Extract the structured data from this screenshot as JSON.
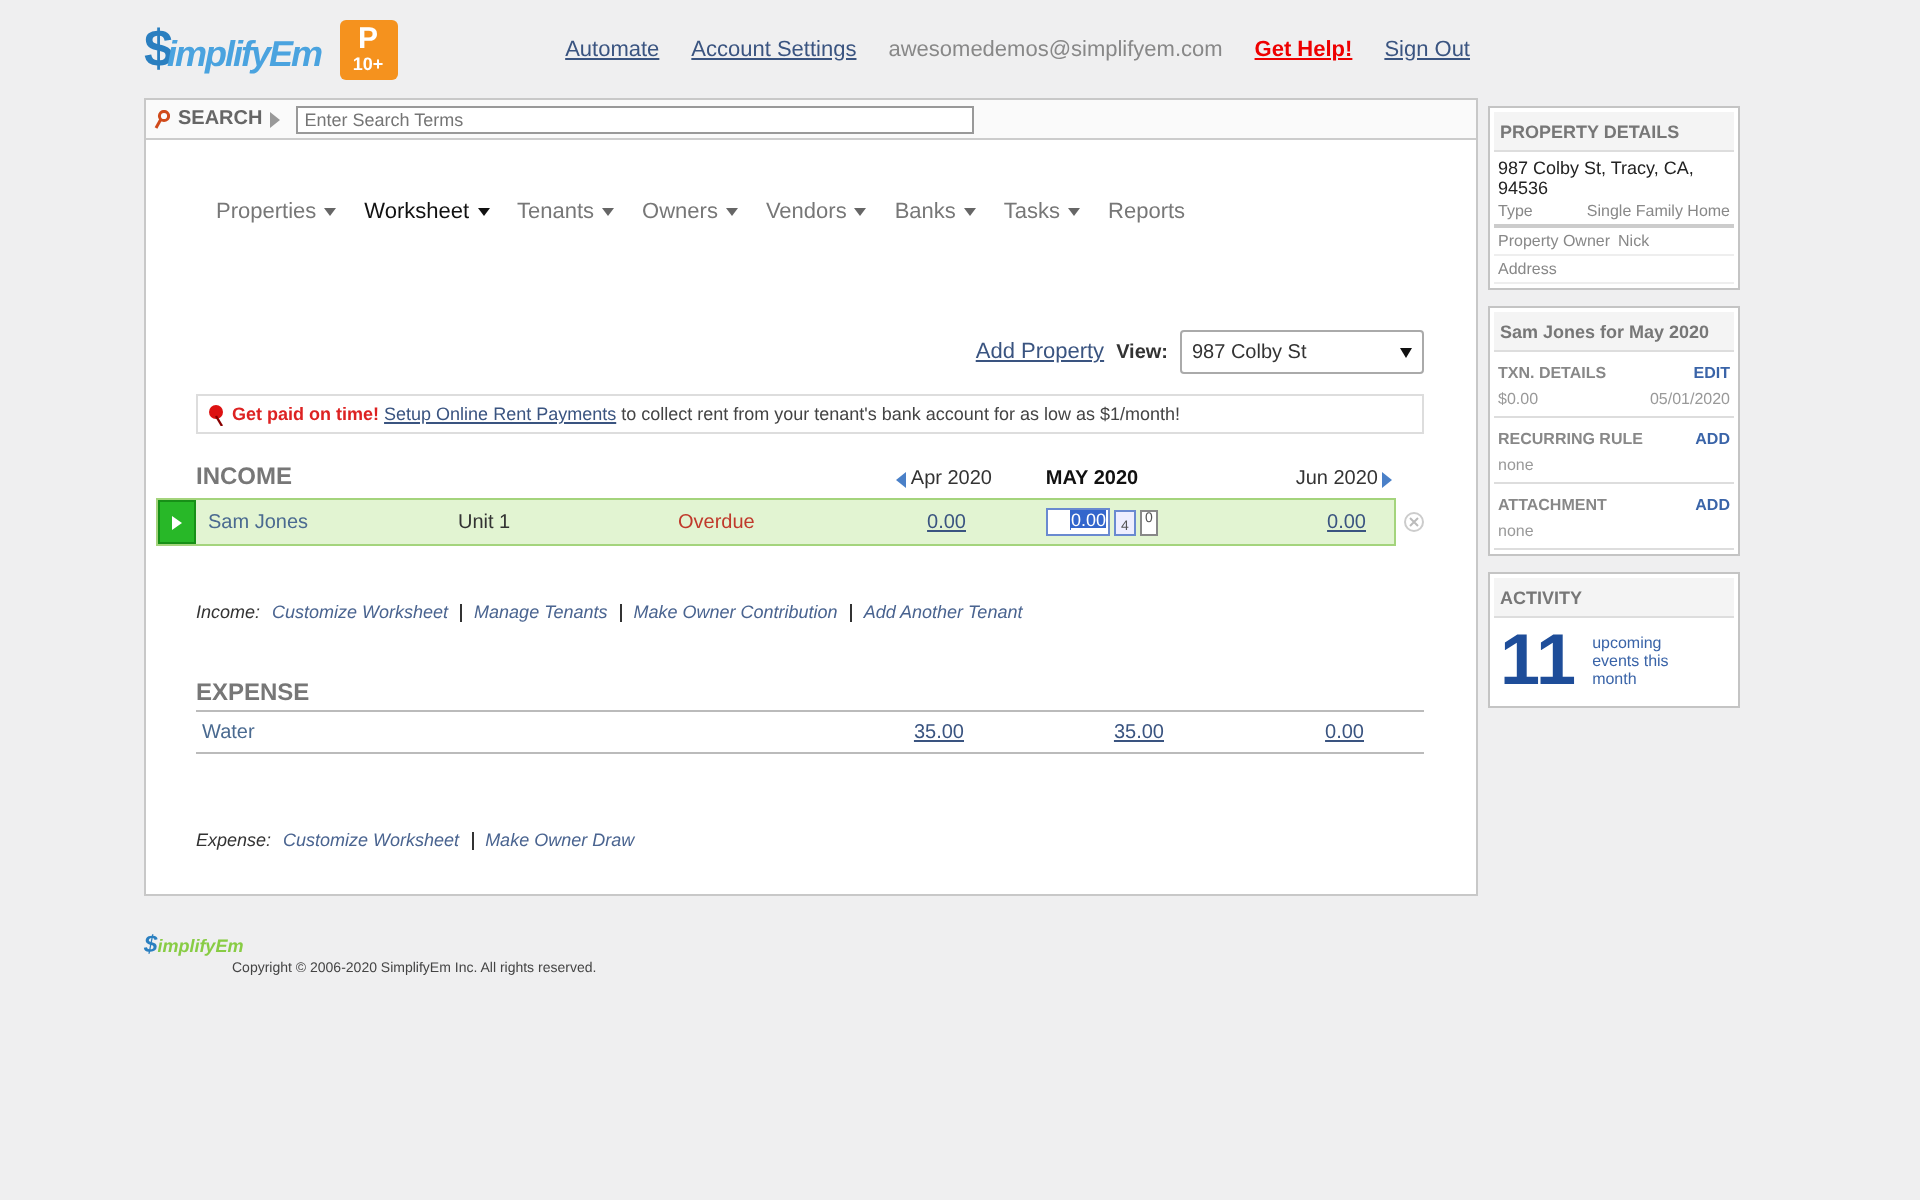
{
  "header": {
    "logo_mark": "$",
    "logo": "implifyEm",
    "badge_letter": "P",
    "badge_sub": "10+",
    "links": [
      {
        "label": "Automate",
        "kind": "link"
      },
      {
        "label": "Account Settings",
        "kind": "link"
      },
      {
        "label": "awesomedemos@simplifyem.com",
        "kind": "email"
      },
      {
        "label": "Get Help!",
        "kind": "help"
      },
      {
        "label": "Sign Out",
        "kind": "link"
      }
    ]
  },
  "search": {
    "label": "SEARCH",
    "placeholder": "Enter Search Terms"
  },
  "nav": [
    {
      "label": "Properties",
      "dropdown": true,
      "selected": false
    },
    {
      "label": "Worksheet",
      "dropdown": true,
      "selected": true
    },
    {
      "label": "Tenants",
      "dropdown": true,
      "selected": false
    },
    {
      "label": "Owners",
      "dropdown": true,
      "selected": false
    },
    {
      "label": "Vendors",
      "dropdown": true,
      "selected": false
    },
    {
      "label": "Banks",
      "dropdown": true,
      "selected": false
    },
    {
      "label": "Tasks",
      "dropdown": true,
      "selected": false
    },
    {
      "label": "Reports",
      "dropdown": false,
      "selected": false
    }
  ],
  "view": {
    "add_link": "Add Property",
    "label": "View:",
    "value": "987 Colby St"
  },
  "promo": {
    "lead": "Get paid on time!",
    "link": "Setup Online Rent Payments",
    "text": "to collect rent from your tenant's bank account for as low as $1/month!"
  },
  "income": {
    "title": "INCOME",
    "months": [
      {
        "label": "Apr 2020",
        "current": false,
        "prev_arrow": true,
        "next_arrow": false
      },
      {
        "label": "MAY 2020",
        "current": true,
        "prev_arrow": false,
        "next_arrow": false
      },
      {
        "label": "Jun 2020",
        "current": false,
        "prev_arrow": false,
        "next_arrow": true
      }
    ],
    "rows": [
      {
        "name": "Sam Jones",
        "unit": "Unit 1",
        "status": "Overdue",
        "values": [
          {
            "amount": "0.00",
            "editing": false
          },
          {
            "amount": "0.00",
            "editing": true
          },
          {
            "amount": "0.00",
            "editing": false
          }
        ],
        "calendar_count": "4",
        "note_count": "0"
      }
    ],
    "links_label": "Income:",
    "links": [
      "Customize Worksheet",
      "Manage Tenants",
      "Make Owner Contribution",
      "Add Another Tenant"
    ]
  },
  "expense": {
    "title": "EXPENSE",
    "rows": [
      {
        "name": "Water",
        "values": [
          "35.00",
          "35.00",
          "0.00"
        ]
      }
    ],
    "links_label": "Expense:",
    "links": [
      "Customize Worksheet",
      "Make Owner Draw"
    ]
  },
  "footer": {
    "logo_mark": "$",
    "logo": "implifyEm",
    "copyright": "Copyright © 2006-2020 SimplifyEm Inc. All rights reserved."
  },
  "sidebar": {
    "property": {
      "title": "PROPERTY DETAILS",
      "address": "987 Colby St, Tracy, CA, 94536",
      "fields": [
        {
          "label": "Type",
          "value": "Single Family Home"
        },
        {
          "label": "Property Owner",
          "value": "Nick"
        },
        {
          "label": "Address"
        }
      ]
    },
    "transaction": {
      "title": "Sam Jones for May 2020",
      "sections": [
        {
          "title": "TXN. DETAILS",
          "action": "EDIT",
          "values": [
            "$0.00",
            "05/01/2020"
          ]
        },
        {
          "title": "RECURRING RULE",
          "action": "ADD",
          "values": [
            "none"
          ]
        },
        {
          "title": "ATTACHMENT",
          "action": "ADD",
          "values": [
            "none"
          ]
        }
      ]
    },
    "activity": {
      "title": "ACTIVITY",
      "count": "11",
      "text": "upcoming events this month"
    }
  }
}
